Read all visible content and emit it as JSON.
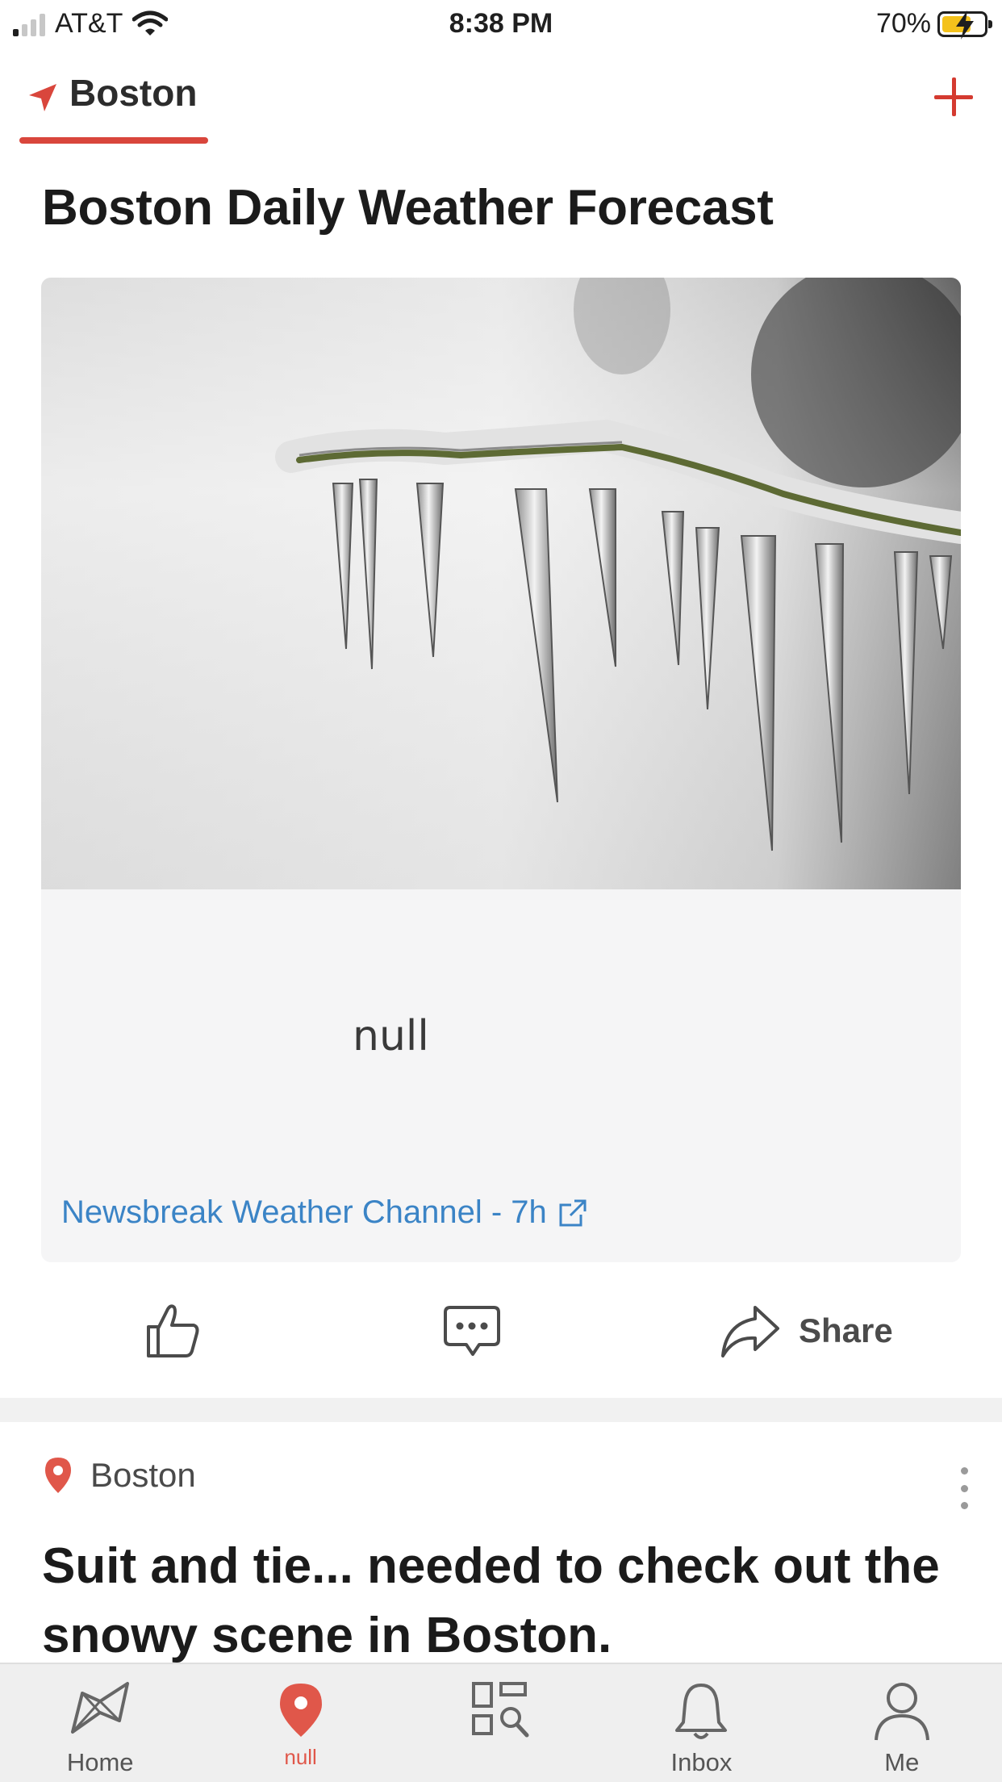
{
  "status_bar": {
    "carrier": "AT&T",
    "time": "8:38 PM",
    "battery_percent": "70%",
    "battery_level": 0.7
  },
  "location_bar": {
    "active_location": "Boston",
    "accent_color": "#d9463c"
  },
  "card1": {
    "title": "Boston Daily Weather Forecast",
    "image_icon": "icicles-photo",
    "placeholder_text": "null",
    "source": "Newsbreak Weather Channel - 7h",
    "actions": {
      "like_icon": "thumbs-up-icon",
      "comment_icon": "comment-icon",
      "share_label": "Share"
    }
  },
  "card2": {
    "location": "Boston",
    "headline": "Suit and tie... needed to check out the snowy scene in Boston."
  },
  "bottom_nav": {
    "items": [
      {
        "label": "Home",
        "icon": "map-icon"
      },
      {
        "label": "null",
        "icon": "location-pin-icon",
        "active": true
      },
      {
        "label": "",
        "icon": "discover-grid-icon"
      },
      {
        "label": "Inbox",
        "icon": "bell-icon"
      },
      {
        "label": "Me",
        "icon": "person-icon"
      }
    ],
    "active_color": "#e0574a"
  }
}
